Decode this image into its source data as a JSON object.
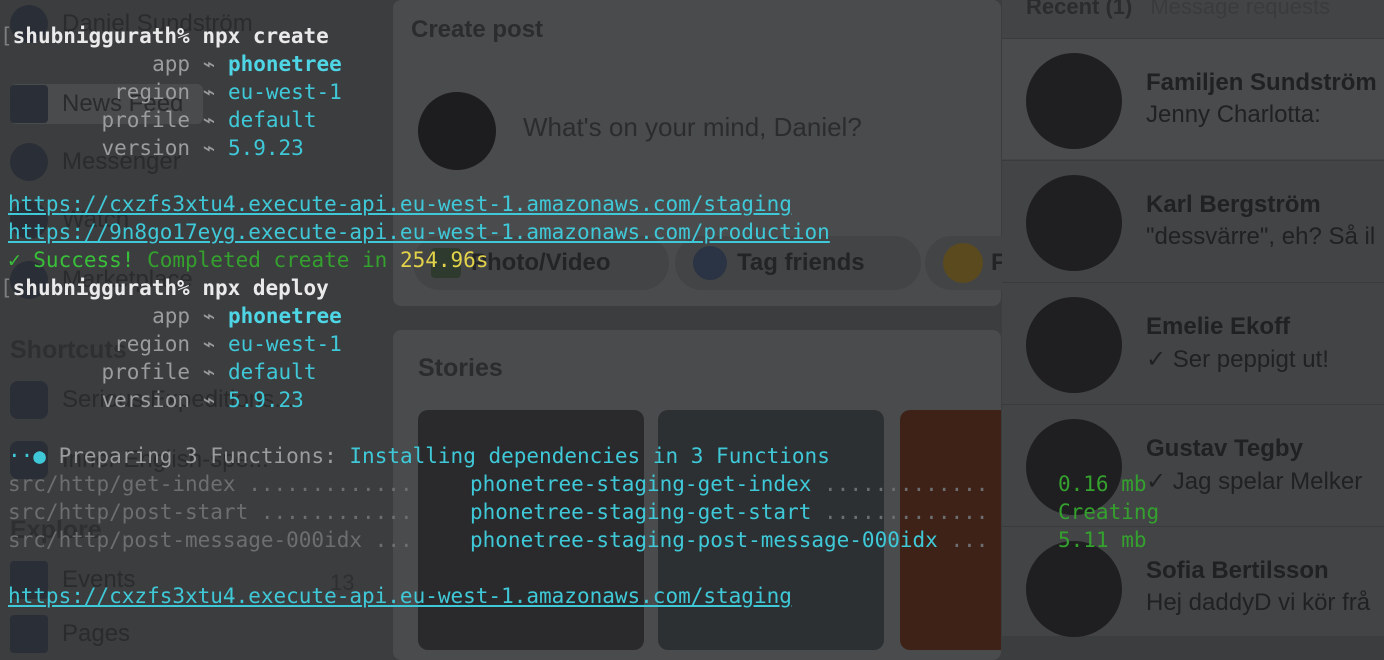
{
  "background": {
    "sidebar": {
      "user_name": "Daniel Sundström",
      "items": [
        {
          "label": "News Feed"
        },
        {
          "label": "Messenger"
        },
        {
          "label": "Watch"
        },
        {
          "label": "Marketplace"
        }
      ],
      "shortcuts_heading": "Shortcuts",
      "shortcuts": [
        "Serious Expeditions...",
        "Inner English-spe..."
      ],
      "explore_heading": "Explore",
      "explore_items": [
        {
          "label": "Events",
          "count": "13"
        },
        {
          "label": "Pages"
        }
      ]
    },
    "create_post": {
      "heading": "Create post",
      "placeholder": "What's on your mind, Daniel?",
      "buttons": [
        "Photo/Video",
        "Tag friends",
        "F"
      ]
    },
    "stories": {
      "heading": "Stories"
    },
    "contacts": {
      "tab_recent": "Recent (1)",
      "tab_requests": "Message requests",
      "conversations": [
        {
          "name": "Familjen Sundström",
          "message": "Jenny Charlotta:"
        },
        {
          "name": "Karl Bergström",
          "message": "\"dessvärre\", eh? Så il"
        },
        {
          "name": "Emelie Ekoff",
          "message": "✓ Ser peppigt ut!"
        },
        {
          "name": "Gustav Tegby",
          "message": "✓ Jag spelar Melker"
        },
        {
          "name": "Sofia Bertilsson",
          "message": "Hej daddyD vi kör frå"
        }
      ]
    }
  },
  "terminal": {
    "prompt_bracket": "[",
    "user": "shubniggurath%",
    "cmd_create": "npx create",
    "cmd_deploy": "npx deploy",
    "arrow": "⌁",
    "info": [
      {
        "label": "app",
        "value": "phonetree"
      },
      {
        "label": "region",
        "value": "eu-west-1"
      },
      {
        "label": "profile",
        "value": "default"
      },
      {
        "label": "version",
        "value": "5.9.23"
      }
    ],
    "url_staging": "https://cxzfs3xtu4.execute-api.eu-west-1.amazonaws.com/staging",
    "url_production": "https://9n8go17eyg.execute-api.eu-west-1.amazonaws.com/production",
    "success_mark": "✓ Success!",
    "success_text": "Completed create in",
    "success_time": "254.96s",
    "spinner": "··●",
    "preparing_label": "Preparing 3 Functions:",
    "preparing_text": "Installing dependencies in 3 Functions",
    "functions": [
      {
        "src": "src/http/get-index",
        "dots1": ".............",
        "name": "phonetree-staging-get-index",
        "dots2": ".............",
        "status": "0.16 mb"
      },
      {
        "src": "src/http/post-start",
        "dots1": "............",
        "name": "phonetree-staging-get-start",
        "dots2": ".............",
        "status": "Creating"
      },
      {
        "src": "src/http/post-message-000idx",
        "dots1": "...",
        "name": "phonetree-staging-post-message-000idx",
        "dots2": "...",
        "status": "5.11 mb"
      }
    ],
    "final_url": "https://cxzfs3xtu4.execute-api.eu-west-1.amazonaws.com/staging"
  }
}
